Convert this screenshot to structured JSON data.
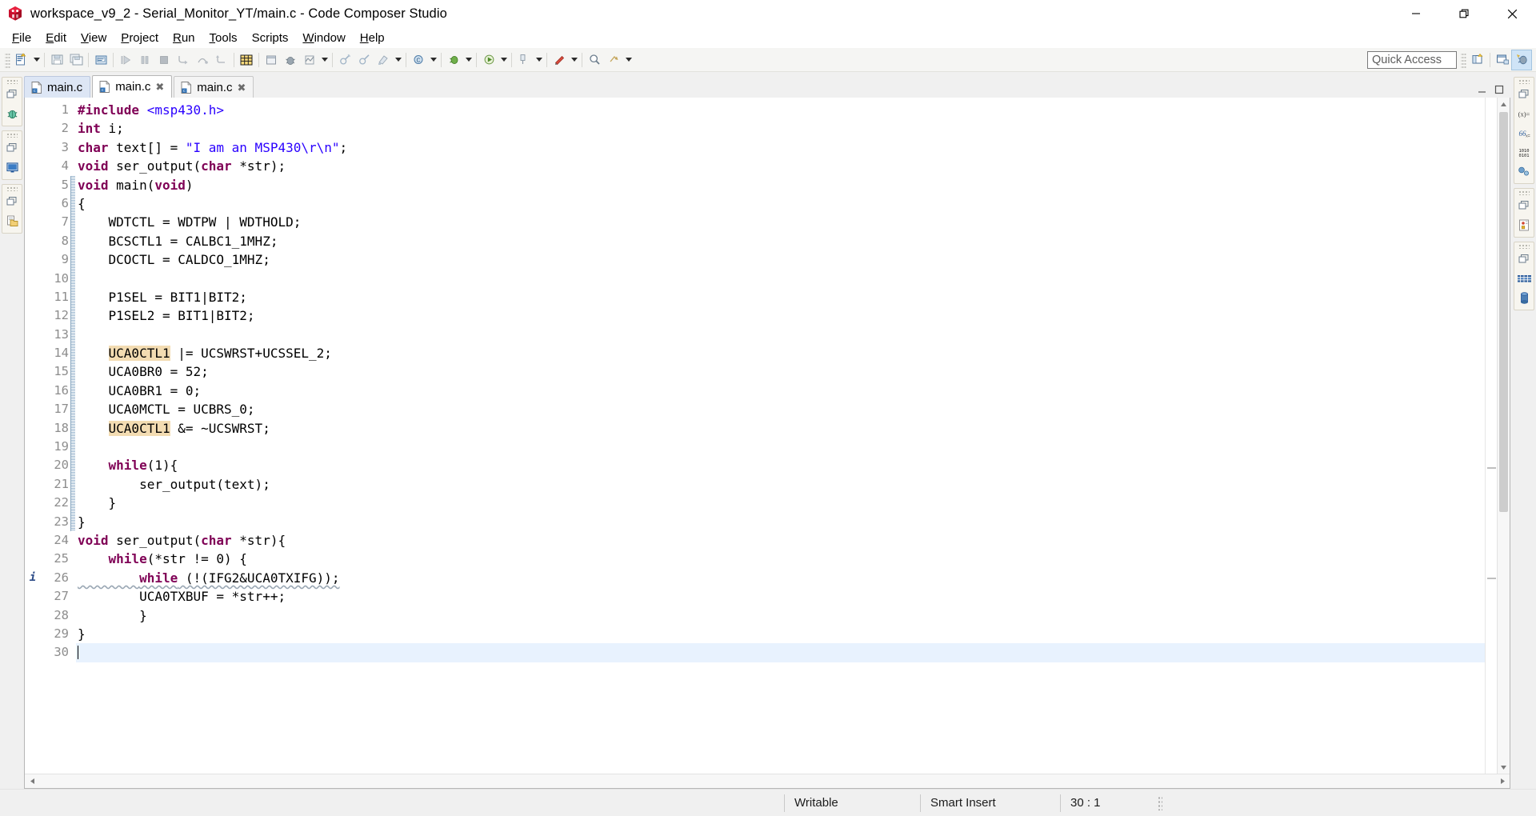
{
  "window": {
    "title": "workspace_v9_2 - Serial_Monitor_YT/main.c - Code Composer Studio",
    "logo_icon": "ccs-cube-logo",
    "controls": [
      {
        "name": "minimize-button",
        "icon": "minimize-icon",
        "label": "—"
      },
      {
        "name": "restore-button",
        "icon": "restore-icon",
        "label": "❐"
      },
      {
        "name": "close-button",
        "icon": "close-icon",
        "label": "✕"
      }
    ]
  },
  "menubar": {
    "items": [
      {
        "label": "File",
        "mnemonic": "F"
      },
      {
        "label": "Edit",
        "mnemonic": "E"
      },
      {
        "label": "View",
        "mnemonic": "V"
      },
      {
        "label": "Project",
        "mnemonic": "P"
      },
      {
        "label": "Run",
        "mnemonic": "R"
      },
      {
        "label": "Tools",
        "mnemonic": "T"
      },
      {
        "label": "Scripts",
        "mnemonic": "S"
      },
      {
        "label": "Window",
        "mnemonic": "W"
      },
      {
        "label": "Help",
        "mnemonic": "H"
      }
    ]
  },
  "toolbar": {
    "buttons": [
      {
        "name": "new-button",
        "icon": "new-file-icon"
      },
      {
        "name": "new-dropdown",
        "icon": "chevron-down-icon"
      },
      {
        "name": "save-button",
        "icon": "save-icon"
      },
      {
        "name": "save-all-button",
        "icon": "save-all-icon"
      },
      {
        "name": "print-button",
        "icon": "print-icon"
      },
      {
        "name": "resume-button",
        "icon": "resume-icon"
      },
      {
        "name": "suspend-button",
        "icon": "suspend-icon"
      },
      {
        "name": "terminate-button",
        "icon": "terminate-icon"
      },
      {
        "name": "step-into-button",
        "icon": "step-into-icon"
      },
      {
        "name": "step-over-button",
        "icon": "step-over-icon"
      },
      {
        "name": "step-return-button",
        "icon": "step-return-icon"
      },
      {
        "name": "build-button",
        "icon": "build-hammer-icon"
      },
      {
        "name": "build-active-button",
        "icon": "build-active-icon"
      },
      {
        "name": "debug-button",
        "icon": "debug-bug-icon"
      },
      {
        "name": "new-target-config-button",
        "icon": "target-config-icon"
      },
      {
        "name": "run-dropdown",
        "icon": "chevron-down-icon"
      },
      {
        "name": "external-tools-button",
        "icon": "external-tools-icon"
      },
      {
        "name": "external-tools-2-button",
        "icon": "external-tools-icon"
      },
      {
        "name": "search-button",
        "icon": "search-icon"
      },
      {
        "name": "search-dropdown",
        "icon": "chevron-down-icon"
      },
      {
        "name": "new-c-project-button",
        "icon": "new-c-project-icon"
      },
      {
        "name": "new-c-project-dropdown",
        "icon": "chevron-down-icon"
      },
      {
        "name": "link-button",
        "icon": "link-icon"
      },
      {
        "name": "link-dropdown",
        "icon": "chevron-down-icon"
      },
      {
        "name": "pencil-button",
        "icon": "pencil-icon"
      },
      {
        "name": "pencil-dropdown",
        "icon": "chevron-down-icon"
      },
      {
        "name": "next-annotation-button",
        "icon": "next-annotation-icon"
      },
      {
        "name": "previous-annotation-button",
        "icon": "previous-annotation-icon"
      },
      {
        "name": "last-edit-button",
        "icon": "last-edit-location-icon"
      },
      {
        "name": "back-dropdown",
        "icon": "chevron-down-icon"
      }
    ],
    "quick_access": {
      "name": "quick-access-input",
      "placeholder": "Quick Access",
      "value": "Quick Access"
    },
    "perspectives": [
      {
        "name": "open-perspective-button",
        "icon": "open-perspective-icon"
      },
      {
        "name": "ccs-edit-perspective-button",
        "icon": "ccs-edit-perspective-icon"
      },
      {
        "name": "ccs-debug-perspective-button",
        "icon": "ccs-debug-perspective-icon",
        "active": true
      }
    ]
  },
  "left_rail": {
    "groups": [
      {
        "name": "debug-view-group",
        "restore_icon": "restore-view-icon",
        "icon": "debug-bug-icon",
        "label": "Debug"
      },
      {
        "name": "console-view-group",
        "restore_icon": "restore-view-icon",
        "icon": "console-icon",
        "label": "Console"
      },
      {
        "name": "project-explorer-group",
        "restore_icon": "restore-view-icon",
        "icon": "project-explorer-icon",
        "label": "Project Explorer"
      }
    ]
  },
  "right_rail": {
    "groups": [
      {
        "name": "variables-view-group",
        "restore_icon": "restore-view-icon",
        "icons": [
          {
            "name": "variables-icon",
            "glyph": "(x)="
          },
          {
            "name": "expressions-icon",
            "glyph": "66"
          },
          {
            "name": "registers-icon",
            "glyph": "1010 0101"
          },
          {
            "name": "breakpoints-icon",
            "glyph": "breakpoints"
          }
        ]
      },
      {
        "name": "disassembly-view-group",
        "restore_icon": "restore-view-icon",
        "icons": [
          {
            "name": "disassembly-icon",
            "glyph": "disassembly"
          }
        ]
      },
      {
        "name": "memory-view-group",
        "restore_icon": "restore-view-icon",
        "icons": [
          {
            "name": "memory-browser-icon",
            "glyph": "memory"
          },
          {
            "name": "memory-cylinder-icon",
            "glyph": "db"
          }
        ]
      }
    ]
  },
  "editor": {
    "tabs": [
      {
        "name": "editor-tab-main-c-1",
        "label": "main.c",
        "icon": "c-file-icon",
        "state": "selected-inactive",
        "closable": false
      },
      {
        "name": "editor-tab-main-c-2",
        "label": "main.c",
        "icon": "c-file-icon",
        "state": "active",
        "closable": true,
        "close_label": "✖"
      },
      {
        "name": "editor-tab-main-c-3",
        "label": "main.c",
        "icon": "c-file-icon",
        "state": "inactive",
        "closable": true,
        "close_label": "✖"
      }
    ],
    "tab_controls": [
      {
        "name": "minimize-editor-button",
        "icon": "minimize-icon"
      },
      {
        "name": "maximize-editor-button",
        "icon": "maximize-icon"
      }
    ],
    "file_name": "main.c",
    "lines": [
      {
        "num": 1,
        "annotation": "",
        "fold": false,
        "current": false,
        "tokens": [
          {
            "t": "#include ",
            "c": "pre"
          },
          {
            "t": "<msp430.h>",
            "c": "hdr"
          }
        ]
      },
      {
        "num": 2,
        "annotation": "",
        "fold": false,
        "current": false,
        "tokens": [
          {
            "t": "int",
            "c": "kw"
          },
          {
            "t": " i;",
            "c": "plain"
          }
        ]
      },
      {
        "num": 3,
        "annotation": "",
        "fold": false,
        "current": false,
        "tokens": [
          {
            "t": "char",
            "c": "kw"
          },
          {
            "t": " text[] = ",
            "c": "plain"
          },
          {
            "t": "\"I am an MSP430\\r\\n\"",
            "c": "str"
          },
          {
            "t": ";",
            "c": "plain"
          }
        ]
      },
      {
        "num": 4,
        "annotation": "",
        "fold": false,
        "current": false,
        "tokens": [
          {
            "t": "void",
            "c": "kw"
          },
          {
            "t": " ser_output(",
            "c": "plain"
          },
          {
            "t": "char",
            "c": "kw"
          },
          {
            "t": " *str);",
            "c": "plain"
          }
        ]
      },
      {
        "num": 5,
        "annotation": "",
        "fold": true,
        "current": false,
        "tokens": [
          {
            "t": "void",
            "c": "kw"
          },
          {
            "t": " main(",
            "c": "plain"
          },
          {
            "t": "void",
            "c": "kw"
          },
          {
            "t": ")",
            "c": "plain"
          }
        ]
      },
      {
        "num": 6,
        "annotation": "",
        "fold": true,
        "current": false,
        "tokens": [
          {
            "t": "{",
            "c": "plain"
          }
        ]
      },
      {
        "num": 7,
        "annotation": "",
        "fold": true,
        "current": false,
        "tokens": [
          {
            "t": "    WDTCTL = WDTPW | WDTHOLD;",
            "c": "plain"
          }
        ]
      },
      {
        "num": 8,
        "annotation": "",
        "fold": true,
        "current": false,
        "tokens": [
          {
            "t": "    BCSCTL1 = CALBC1_1MHZ;",
            "c": "plain"
          }
        ]
      },
      {
        "num": 9,
        "annotation": "",
        "fold": true,
        "current": false,
        "tokens": [
          {
            "t": "    DCOCTL = CALDCO_1MHZ;",
            "c": "plain"
          }
        ]
      },
      {
        "num": 10,
        "annotation": "",
        "fold": true,
        "current": false,
        "tokens": []
      },
      {
        "num": 11,
        "annotation": "",
        "fold": true,
        "current": false,
        "tokens": [
          {
            "t": "    P1SEL = BIT1|BIT2;",
            "c": "plain"
          }
        ]
      },
      {
        "num": 12,
        "annotation": "",
        "fold": true,
        "current": false,
        "tokens": [
          {
            "t": "    P1SEL2 = BIT1|BIT2;",
            "c": "plain"
          }
        ]
      },
      {
        "num": 13,
        "annotation": "",
        "fold": true,
        "current": false,
        "tokens": []
      },
      {
        "num": 14,
        "annotation": "",
        "fold": true,
        "current": false,
        "tokens": [
          {
            "t": "    ",
            "c": "plain"
          },
          {
            "t": "UCA0CTL1",
            "c": "occ"
          },
          {
            "t": " |= UCSWRST+UCSSEL_2;",
            "c": "plain"
          }
        ]
      },
      {
        "num": 15,
        "annotation": "",
        "fold": true,
        "current": false,
        "tokens": [
          {
            "t": "    UCA0BR0 = 52;",
            "c": "plain"
          }
        ]
      },
      {
        "num": 16,
        "annotation": "",
        "fold": true,
        "current": false,
        "tokens": [
          {
            "t": "    UCA0BR1 = 0;",
            "c": "plain"
          }
        ]
      },
      {
        "num": 17,
        "annotation": "",
        "fold": true,
        "current": false,
        "tokens": [
          {
            "t": "    UCA0MCTL = UCBRS_0;",
            "c": "plain"
          }
        ]
      },
      {
        "num": 18,
        "annotation": "",
        "fold": true,
        "current": false,
        "tokens": [
          {
            "t": "    ",
            "c": "plain"
          },
          {
            "t": "UCA0CTL1",
            "c": "occ"
          },
          {
            "t": " &= ~UCSWRST;",
            "c": "plain"
          }
        ]
      },
      {
        "num": 19,
        "annotation": "",
        "fold": true,
        "current": false,
        "tokens": []
      },
      {
        "num": 20,
        "annotation": "",
        "fold": true,
        "current": false,
        "tokens": [
          {
            "t": "    ",
            "c": "plain"
          },
          {
            "t": "while",
            "c": "kw"
          },
          {
            "t": "(1){",
            "c": "plain"
          }
        ]
      },
      {
        "num": 21,
        "annotation": "",
        "fold": true,
        "current": false,
        "tokens": [
          {
            "t": "        ser_output(text);",
            "c": "plain"
          }
        ]
      },
      {
        "num": 22,
        "annotation": "",
        "fold": true,
        "current": false,
        "tokens": [
          {
            "t": "    }",
            "c": "plain"
          }
        ]
      },
      {
        "num": 23,
        "annotation": "",
        "fold": true,
        "current": false,
        "tokens": [
          {
            "t": "}",
            "c": "plain"
          }
        ]
      },
      {
        "num": 24,
        "annotation": "",
        "fold": false,
        "current": false,
        "tokens": [
          {
            "t": "void",
            "c": "kw"
          },
          {
            "t": " ser_output(",
            "c": "plain"
          },
          {
            "t": "char",
            "c": "kw"
          },
          {
            "t": " *str){",
            "c": "plain"
          }
        ]
      },
      {
        "num": 25,
        "annotation": "",
        "fold": false,
        "current": false,
        "tokens": [
          {
            "t": "    ",
            "c": "plain"
          },
          {
            "t": "while",
            "c": "kw"
          },
          {
            "t": "(*str != 0) {",
            "c": "plain"
          }
        ]
      },
      {
        "num": 26,
        "annotation": "i",
        "fold": false,
        "current": false,
        "squiggly": true,
        "tokens": [
          {
            "t": "        ",
            "c": "plain"
          },
          {
            "t": "while",
            "c": "kw"
          },
          {
            "t": " (!(IFG2&UCA0TXIFG));",
            "c": "plain"
          }
        ]
      },
      {
        "num": 27,
        "annotation": "",
        "fold": false,
        "current": false,
        "tokens": [
          {
            "t": "        UCA0TXBUF = *str++;",
            "c": "plain"
          }
        ]
      },
      {
        "num": 28,
        "annotation": "",
        "fold": false,
        "current": false,
        "tokens": [
          {
            "t": "        }",
            "c": "plain"
          }
        ]
      },
      {
        "num": 29,
        "annotation": "",
        "fold": false,
        "current": false,
        "tokens": [
          {
            "t": "}",
            "c": "plain"
          }
        ]
      },
      {
        "num": 30,
        "annotation": "",
        "fold": false,
        "current": true,
        "caret": true,
        "tokens": []
      }
    ],
    "scrollbars": {
      "vertical": {
        "name": "editor-vertical-scrollbar",
        "up_icon": "chevron-up-icon",
        "down_icon": "chevron-down-icon"
      },
      "horizontal": {
        "name": "editor-horizontal-scrollbar",
        "left_icon": "chevron-left-icon",
        "right_icon": "chevron-right-icon"
      }
    }
  },
  "statusbar": {
    "cells": [
      {
        "name": "status-writable",
        "label": "Writable"
      },
      {
        "name": "status-insert-mode",
        "label": "Smart Insert"
      },
      {
        "name": "status-cursor-position",
        "label": "30 : 1"
      }
    ]
  },
  "colors": {
    "keyword": "#7f0055",
    "string": "#2a00ff",
    "occurrence_highlight": "#f3dcb2",
    "current_line": "#e8f2fe",
    "active_tab": "#ffffff",
    "selected_inactive_tab": "#dde6f5",
    "chrome": "#f0f0f0"
  }
}
